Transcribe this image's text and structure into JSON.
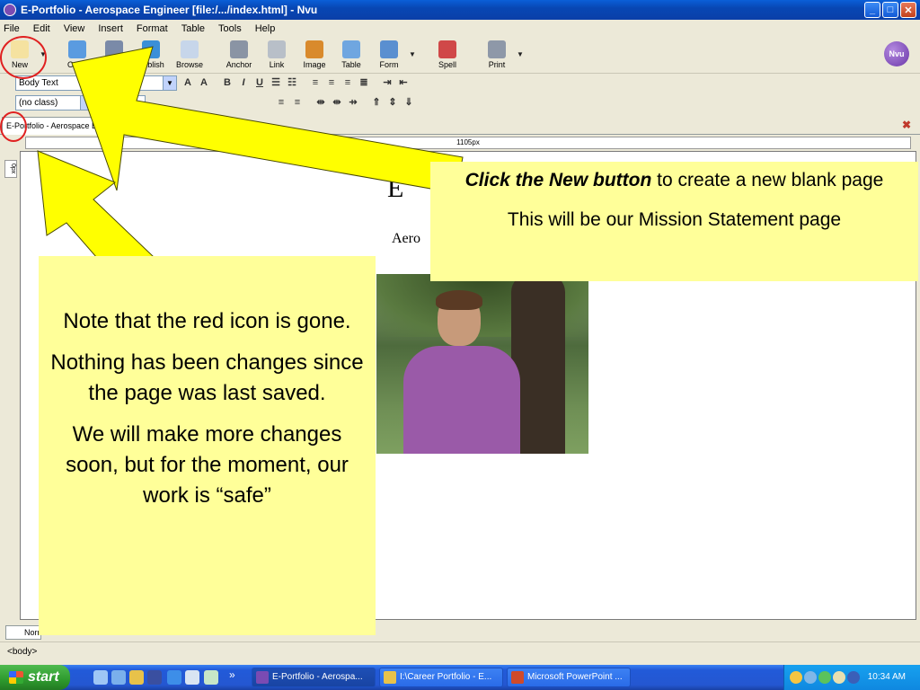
{
  "window": {
    "title": "E-Portfolio - Aerospace Engineer [file:/.../index.html] - Nvu",
    "minimize": "_",
    "maximize": "□",
    "close": "✕"
  },
  "menu": [
    "File",
    "Edit",
    "View",
    "Insert",
    "Format",
    "Table",
    "Tools",
    "Help"
  ],
  "toolbar": {
    "buttons": [
      {
        "label": "New",
        "icon": "new-page-icon",
        "color": "#f5e2a0"
      },
      {
        "label": "Open",
        "icon": "open-icon",
        "color": "#5a9be0"
      },
      {
        "label": "Save",
        "icon": "save-icon",
        "color": "#7a8aa8"
      },
      {
        "label": "Publish",
        "icon": "globe-icon",
        "color": "#3a8fd8"
      },
      {
        "label": "Browse",
        "icon": "magnifier-icon",
        "color": "#c7d6ea"
      },
      {
        "label": "Anchor",
        "icon": "anchor-icon",
        "color": "#8a94a4"
      },
      {
        "label": "Link",
        "icon": "link-icon",
        "color": "#b8bfc8"
      },
      {
        "label": "Image",
        "icon": "image-icon",
        "color": "#d98a2c"
      },
      {
        "label": "Table",
        "icon": "table-icon",
        "color": "#6fa6e0"
      },
      {
        "label": "Form",
        "icon": "form-icon",
        "color": "#5a8fd0"
      },
      {
        "label": "Spell",
        "icon": "spellcheck-icon",
        "color": "#d04848"
      },
      {
        "label": "Print",
        "icon": "printer-icon",
        "color": "#8e98a8"
      }
    ],
    "logo": "Nvu"
  },
  "format": {
    "paragraph_style": "Body Text",
    "class_select": "(no class)",
    "font_select": "Va",
    "bold": "B",
    "italic": "I",
    "underline": "U",
    "text_size": "A"
  },
  "tab": {
    "label": "E-Portfolio - Aerospace Engineer",
    "close": "✖"
  },
  "ruler": {
    "width_label": "1105px",
    "side_label": "0px"
  },
  "page": {
    "heading": "E",
    "subtitle": "Aero"
  },
  "modes": {
    "normal": "Normal"
  },
  "status": {
    "path": "<body>"
  },
  "taskbar": {
    "start": "start",
    "more": "»",
    "tasks": [
      {
        "label": "E-Portfolio - Aerospa...",
        "color": "#7a4bb3"
      },
      {
        "label": "I:\\Career Portfolio - E...",
        "color": "#e8c24a"
      },
      {
        "label": "Microsoft PowerPoint ...",
        "color": "#d04a2a"
      }
    ],
    "clock": "10:34 AM"
  },
  "annotations": {
    "right": {
      "emphasis": "Click the New button",
      "rest": "to create a new blank page",
      "line2": "This will be our Mission Statement page"
    },
    "left": {
      "p1": "Note that the red icon is gone.",
      "p2": "Nothing has been  changes since the page was last saved.",
      "p3": "We will make more changes soon, but for the moment, our work is “safe”"
    },
    "highlight_color": "#ffff99",
    "arrow_color": "#ffff00",
    "circle_color": "#e02020"
  }
}
